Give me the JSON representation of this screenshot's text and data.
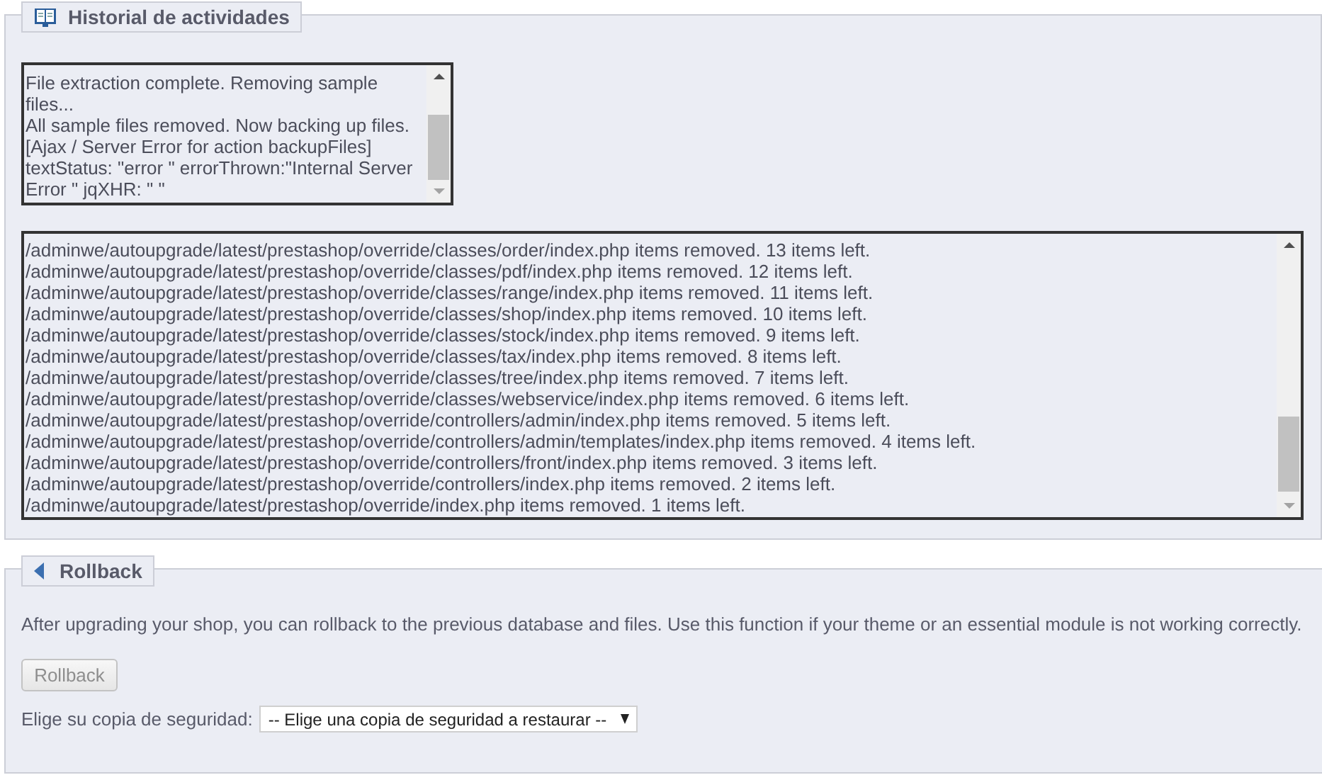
{
  "activity_panel": {
    "title": "Historial de actividades",
    "summary_log": [
      "File extraction complete. Removing sample files...",
      "All sample files removed. Now backing up files.",
      "[Ajax / Server Error for action backupFiles] textStatus: \"error \" errorThrown:\"Internal Server Error \" jqXHR: \" \""
    ],
    "detail_log": [
      "/adminwe/autoupgrade/latest/prestashop/override/classes/order/index.php items removed. 13 items left.",
      "/adminwe/autoupgrade/latest/prestashop/override/classes/pdf/index.php items removed. 12 items left.",
      "/adminwe/autoupgrade/latest/prestashop/override/classes/range/index.php items removed. 11 items left.",
      "/adminwe/autoupgrade/latest/prestashop/override/classes/shop/index.php items removed. 10 items left.",
      "/adminwe/autoupgrade/latest/prestashop/override/classes/stock/index.php items removed. 9 items left.",
      "/adminwe/autoupgrade/latest/prestashop/override/classes/tax/index.php items removed. 8 items left.",
      "/adminwe/autoupgrade/latest/prestashop/override/classes/tree/index.php items removed. 7 items left.",
      "/adminwe/autoupgrade/latest/prestashop/override/classes/webservice/index.php items removed. 6 items left.",
      "/adminwe/autoupgrade/latest/prestashop/override/controllers/admin/index.php items removed. 5 items left.",
      "/adminwe/autoupgrade/latest/prestashop/override/controllers/admin/templates/index.php items removed. 4 items left.",
      "/adminwe/autoupgrade/latest/prestashop/override/controllers/front/index.php items removed. 3 items left.",
      "/adminwe/autoupgrade/latest/prestashop/override/controllers/index.php items removed. 2 items left.",
      "/adminwe/autoupgrade/latest/prestashop/override/index.php items removed. 1 items left."
    ]
  },
  "rollback_panel": {
    "title": "Rollback",
    "description": "After upgrading your shop, you can rollback to the previous database and files. Use this function if your theme or an essential module is not working correctly.",
    "button": {
      "label": "Rollback",
      "disabled": true
    },
    "backup_select": {
      "label": "Elige su copia de seguridad:",
      "value": "-- Elige una copia de seguridad a restaurar --"
    }
  }
}
